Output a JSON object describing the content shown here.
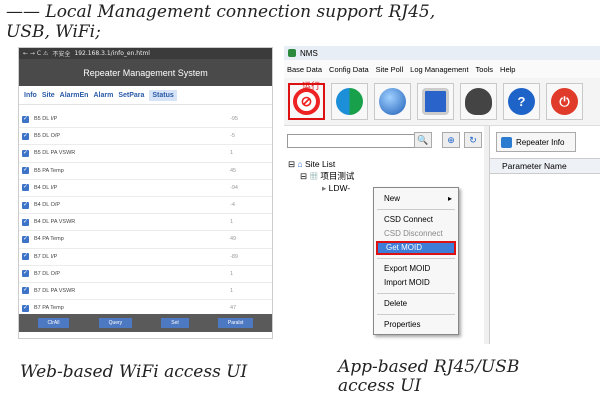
{
  "heading": "—— Local Management connection support RJ45, USB, WiFi;",
  "caption_left": "Web-based WiFi access UI",
  "caption_right": "App-based RJ45/USB access UI",
  "web": {
    "nav_icons": "← → C ⚠",
    "security_label": "不安全",
    "url": "192.168.3.1/info_en.html",
    "title": "Repeater Management System",
    "tabs": [
      "Info",
      "Site",
      "AlarmEn",
      "Alarm",
      "SetPara",
      "Status"
    ],
    "active_tab": "Status",
    "rows": [
      {
        "name": "B5 DL I/P",
        "value": "-95"
      },
      {
        "name": "B5 DL O/P",
        "value": "-5"
      },
      {
        "name": "B5 DL PA VSWR",
        "value": "1"
      },
      {
        "name": "B5 PA Temp",
        "value": "45"
      },
      {
        "name": "B4 DL I/P",
        "value": "-94"
      },
      {
        "name": "B4 DL O/P",
        "value": "-4"
      },
      {
        "name": "B4 DL PA VSWR",
        "value": "1"
      },
      {
        "name": "B4 PA Temp",
        "value": "49"
      },
      {
        "name": "B7 DL I/P",
        "value": "-89"
      },
      {
        "name": "B7 DL O/P",
        "value": "1"
      },
      {
        "name": "B7 DL PA VSWR",
        "value": "1"
      },
      {
        "name": "B7 PA Temp",
        "value": "47"
      }
    ],
    "buttons": [
      "ClrAll",
      "Query",
      "Set",
      "Paralst"
    ]
  },
  "app": {
    "title": "NMS",
    "menu": [
      "Base Data",
      "Config Data",
      "Site Poll",
      "Log Management",
      "Tools",
      "Help"
    ],
    "tab_label": "Repeater Info",
    "table_header": "Parameter Name",
    "tree": {
      "root": "Site List",
      "project": "项目测试",
      "device": "LDW-"
    },
    "annotation": "运行",
    "context_menu": [
      "New",
      "CSD Connect",
      "CSD Disconnect",
      "Get MOID",
      "Export MOID",
      "Import MOID",
      "Delete",
      "Properties"
    ]
  },
  "colors": {
    "accent_blue": "#3e7ed9",
    "highlight_red": "#dd1111"
  }
}
